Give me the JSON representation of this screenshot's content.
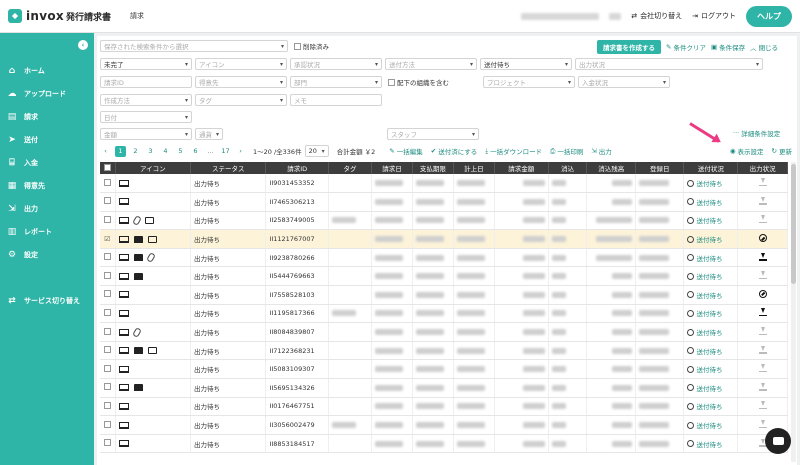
{
  "header": {
    "logo": "invox",
    "logo_sub": "発行請求書",
    "tab": "請求",
    "company_switch": "会社切り替え",
    "logout": "ログアウト",
    "help": "ヘルプ"
  },
  "sidebar": {
    "items": [
      {
        "label": "ホーム",
        "icon": "home-icon"
      },
      {
        "label": "アップロード",
        "icon": "cloud-upload-icon"
      },
      {
        "label": "請求",
        "icon": "invoice-icon"
      },
      {
        "label": "送付",
        "icon": "send-icon"
      },
      {
        "label": "入金",
        "icon": "bank-icon"
      },
      {
        "label": "得意先",
        "icon": "customers-icon"
      },
      {
        "label": "出力",
        "icon": "export-icon"
      },
      {
        "label": "レポート",
        "icon": "report-icon"
      },
      {
        "label": "設定",
        "icon": "gear-icon"
      }
    ],
    "service_switch": "サービス切り替え"
  },
  "filters": {
    "saved_search_placeholder": "保存された検索条件から選択",
    "deleted_label": "削除済み",
    "create_invoice": "請求書を作成する",
    "clear": "条件クリア",
    "save": "条件保存",
    "close": "閉じる",
    "status_value": "未完了",
    "icon_ph": "アイコン",
    "approval_ph": "承認状況",
    "send_method_ph": "送付方法",
    "send_status_value": "送付待ち",
    "output_status_ph": "出力状況",
    "invoice_id_ph": "請求ID",
    "customer_ph": "得意先",
    "dept_ph": "部門",
    "subordinate_label": "配下の組織を含む",
    "project_ph": "プロジェクト",
    "payment_status_ph": "入金状況",
    "create_method_ph": "作成方法",
    "tag_ph": "タグ",
    "memo_ph": "メモ",
    "date_ph": "日付",
    "amount_ph": "金額",
    "currency_ph": "通貨",
    "staff_ph": "スタッフ",
    "advanced": "詳細条件設定"
  },
  "toolbar": {
    "pages": [
      "1",
      "2",
      "3",
      "4",
      "5",
      "6",
      "...",
      "17"
    ],
    "range": "1〜20 /全336件",
    "per_page": "20",
    "total": "合計金額 ￥2",
    "bulk_edit": "一括編集",
    "mark_sent": "送付済にする",
    "bulk_download": "一括ダウンロード",
    "bulk_print": "一括印刷",
    "output": "出力",
    "display_settings": "表示設定",
    "refresh": "更新"
  },
  "table": {
    "columns": [
      "アイコン",
      "ステータス",
      "請求ID",
      "タグ",
      "請求日",
      "支払期限",
      "計上日",
      "請求金額",
      "消込",
      "消込残高",
      "登録日",
      "送付状況",
      "出力状況"
    ],
    "rows": [
      {
        "icons": [
          "pc"
        ],
        "status": "出力待ち",
        "id": "II9031453352",
        "tag": false,
        "sel": false,
        "send": "送付待ち",
        "out": "gray"
      },
      {
        "icons": [
          "pc"
        ],
        "status": "出力待ち",
        "id": "II7465306213",
        "tag": false,
        "sel": false,
        "send": "送付待ち",
        "out": "gray"
      },
      {
        "icons": [
          "pc",
          "clip",
          "comment"
        ],
        "status": "出力待ち",
        "id": "II2583749005",
        "tag": true,
        "sel": false,
        "send": "送付待ち",
        "out": "gray"
      },
      {
        "icons": [
          "pc",
          "book",
          "comment"
        ],
        "status": "出力待ち",
        "id": "II1121767007",
        "tag": false,
        "sel": true,
        "send": "送付待ち",
        "out": "ban"
      },
      {
        "icons": [
          "pc",
          "book",
          "clip"
        ],
        "status": "出力待ち",
        "id": "II9238780266",
        "tag": false,
        "sel": false,
        "send": "送付待ち",
        "out": "black"
      },
      {
        "icons": [
          "pc",
          "book"
        ],
        "status": "出力待ち",
        "id": "II5444769663",
        "tag": false,
        "sel": false,
        "send": "送付待ち",
        "out": "gray"
      },
      {
        "icons": [
          "pc"
        ],
        "status": "出力待ち",
        "id": "II7558528103",
        "tag": false,
        "sel": false,
        "send": "送付待ち",
        "out": "ban"
      },
      {
        "icons": [
          "pc"
        ],
        "status": "出力待ち",
        "id": "II1195817366",
        "tag": true,
        "sel": false,
        "send": "送付待ち",
        "out": "black"
      },
      {
        "icons": [
          "pc",
          "clip"
        ],
        "status": "出力待ち",
        "id": "II8084839807",
        "tag": false,
        "sel": false,
        "send": "送付待ち",
        "out": "gray"
      },
      {
        "icons": [
          "pc",
          "book",
          "comment"
        ],
        "status": "出力待ち",
        "id": "II7122368231",
        "tag": false,
        "sel": false,
        "send": "送付待ち",
        "out": "gray"
      },
      {
        "icons": [
          "pc"
        ],
        "status": "出力待ち",
        "id": "II5083109307",
        "tag": false,
        "sel": false,
        "send": "送付待ち",
        "out": "gray"
      },
      {
        "icons": [
          "pc",
          "book"
        ],
        "status": "出力待ち",
        "id": "II5695134326",
        "tag": false,
        "sel": false,
        "send": "送付待ち",
        "out": "gray"
      },
      {
        "icons": [
          "pc"
        ],
        "status": "出力待ち",
        "id": "II0176467751",
        "tag": false,
        "sel": false,
        "send": "送付待ち",
        "out": "gray"
      },
      {
        "icons": [
          "pc"
        ],
        "status": "出力待ち",
        "id": "II3056002479",
        "tag": true,
        "sel": false,
        "send": "送付待ち",
        "out": "gray"
      },
      {
        "icons": [
          "pc"
        ],
        "status": "出力待ち",
        "id": "II8853184517",
        "tag": false,
        "sel": false,
        "send": "送付待ち",
        "out": "gray"
      }
    ]
  },
  "colors": {
    "accent": "#2fb5a7",
    "arrow": "#ec3b83",
    "header_dark": "#3d3d3d"
  }
}
